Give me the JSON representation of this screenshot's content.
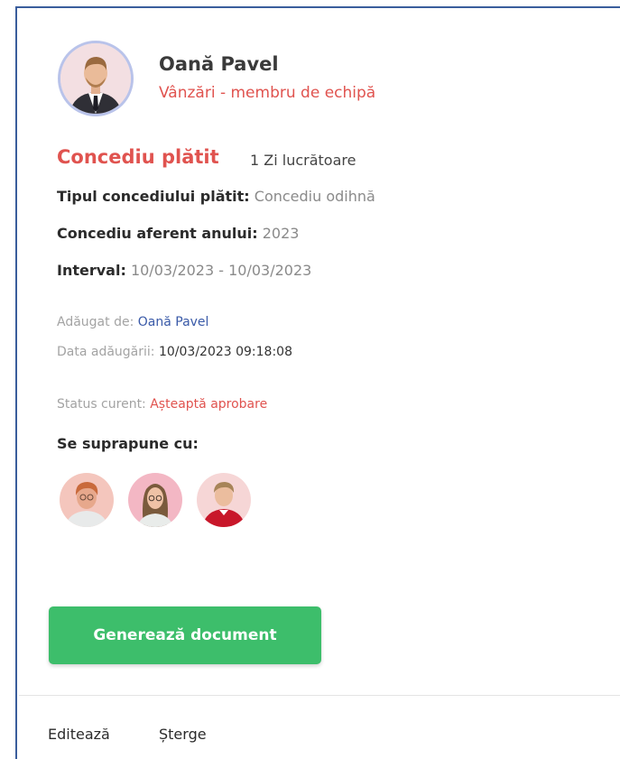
{
  "employee": {
    "name": "Oană Pavel",
    "role": "Vânzări - membru de echipă",
    "avatar_icon": "person-avatar-icon"
  },
  "leave": {
    "type_title": "Concediu plătit",
    "days": "1 Zi lucrătoare",
    "paid_type_label": "Tipul concediului plătit:",
    "paid_type_value": "Concediu odihnă",
    "year_label": "Concediu aferent anului:",
    "year_value": "2023",
    "interval_label": "Interval:",
    "interval_value": "10/03/2023 - 10/03/2023"
  },
  "meta": {
    "added_by_label": "Adăugat de:",
    "added_by_value": "Oană Pavel",
    "added_date_label": "Data adăugării:",
    "added_date_value": "10/03/2023 09:18:08",
    "status_label": "Status curent:",
    "status_value": "Așteaptă aprobare"
  },
  "overlap": {
    "title": "Se suprapune cu:",
    "avatars": [
      "person-avatar-icon",
      "person-avatar-icon",
      "person-avatar-icon"
    ]
  },
  "actions": {
    "generate_label": "Generează document",
    "edit_label": "Editează",
    "delete_label": "Șterge"
  },
  "colors": {
    "accent_red": "#e0534f",
    "button_green": "#3dbe6b",
    "link_blue": "#3a5aa8",
    "border_blue": "#3a5d9c"
  }
}
